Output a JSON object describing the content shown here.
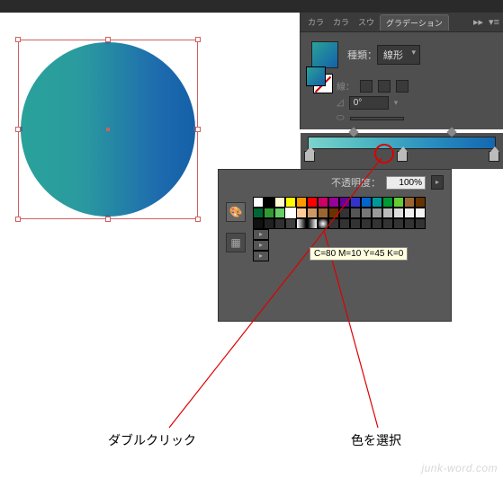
{
  "tabs": [
    "カラ",
    "カラ",
    "スウ",
    "グラデーション"
  ],
  "tab_active_index": 3,
  "panel": {
    "type_label": "種類：",
    "type_value": "線形",
    "stroke_label": "線：",
    "angle_value": "0°",
    "reverse_icon": "reverse-gradient"
  },
  "gradient": {
    "stops_pct": [
      0,
      50,
      100
    ],
    "diamonds_pct": [
      22,
      75
    ]
  },
  "swatch_popup": {
    "opacity_label": "不透明度：",
    "opacity_value": "100%",
    "tooltip": "C=80 M=10 Y=45 K=0",
    "rows": [
      [
        "#ffffff",
        "#000000",
        "#fffbcf",
        "#ffff00",
        "#ff9900",
        "#ff0000",
        "#cc0066",
        "#990099",
        "#660099",
        "#3333cc",
        "#0066cc",
        "#009999",
        "#009933",
        "#66cc33",
        "#996633",
        "#663300"
      ],
      [
        "#006633",
        "#339933",
        "#66cc66",
        "#ffffff",
        "#ffcc99",
        "#cc9966",
        "#996633",
        "#663300",
        "#333333",
        "#555555",
        "#777777",
        "#999999",
        "#bbbbbb",
        "#dddddd",
        "#eeeeee",
        "#f5f5f5"
      ],
      [
        "#101010",
        "#202020",
        "#303030",
        "#404040",
        "#linear",
        "#bw",
        "#radial",
        "#",
        "#",
        "#",
        "#",
        "#",
        "#",
        "#",
        "#",
        "#"
      ]
    ],
    "selected": {
      "row": 1,
      "col": 3
    }
  },
  "callouts": {
    "double_click": "ダブルクリック",
    "select_color": "色を選択"
  },
  "watermark": "junk-word.com"
}
